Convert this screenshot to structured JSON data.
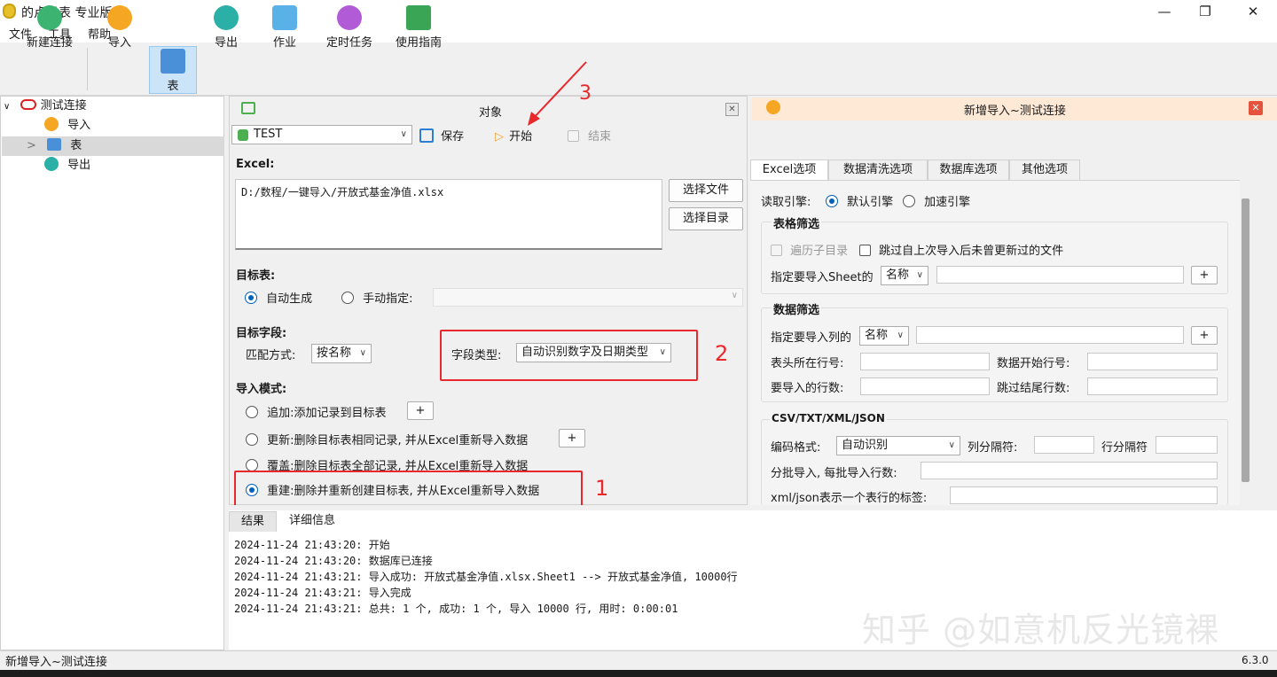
{
  "window": {
    "title": "的卢导表 专业版",
    "minimize": "—",
    "maximize": "❐",
    "close": "✕"
  },
  "menu": [
    "文件",
    "工具",
    "帮助"
  ],
  "toolbar": {
    "new_conn": "新建连接",
    "import": "导入",
    "table": "表",
    "export": "导出",
    "job": "作业",
    "schedule": "定时任务",
    "guide": "使用指南"
  },
  "tree": {
    "root": "测试连接",
    "items": [
      "导入",
      "表",
      "导出"
    ],
    "expander": ">"
  },
  "object_panel": {
    "title": "对象",
    "source_combo": "TEST",
    "save": "保存",
    "start": "开始",
    "stop": "结束",
    "excel_label": "Excel:",
    "excel_path": "D:/数程/一键导入/开放式基金净值.xlsx",
    "choose_file": "选择文件",
    "choose_dir": "选择目录",
    "target_table_label": "目标表:",
    "auto_gen": "自动生成",
    "manual": "手动指定:",
    "target_fields_label": "目标字段:",
    "match_label": "匹配方式:",
    "match_value": "按名称",
    "field_type_label": "字段类型:",
    "field_type_value": "自动识别数字及日期类型",
    "import_mode_label": "导入模式:",
    "modes": [
      "追加:添加记录到目标表",
      "更新:删除目标表相同记录, 并从Excel重新导入数据",
      "覆盖:删除目标表全部记录, 并从Excel重新导入数据",
      "重建:删除并重新创建目标表, 并从Excel重新导入数据"
    ],
    "plus": "+"
  },
  "annotations": [
    "1",
    "2",
    "3"
  ],
  "right_panel": {
    "title": "新增导入~测试连接",
    "tabs": [
      "Excel选项",
      "数据清洗选项",
      "数据库选项",
      "其他选项"
    ],
    "engine_label": "读取引擎:",
    "engine_default": "默认引擎",
    "engine_fast": "加速引擎",
    "sheet_filter": "表格筛选",
    "traverse_sub": "遍历子目录",
    "skip_unchanged": "跳过自上次导入后未曾更新过的文件",
    "specify_sheet": "指定要导入Sheet的",
    "sheet_by": "名称",
    "data_filter": "数据筛选",
    "specify_cols": "指定要导入列的",
    "cols_by": "名称",
    "header_row": "表头所在行号:",
    "data_start_row": "数据开始行号:",
    "rows_to_import": "要导入的行数:",
    "skip_tail_rows": "跳过结尾行数:",
    "csv_group": "CSV/TXT/XML/JSON",
    "encoding_label": "编码格式:",
    "encoding_value": "自动识别",
    "col_sep": "列分隔符:",
    "row_sep": "行分隔符",
    "batch": "分批导入, 每批导入行数:",
    "xml_tag": "xml/json表示一个表行的标签:"
  },
  "results": {
    "tabs": [
      "结果",
      "详细信息"
    ],
    "logs": [
      "2024-11-24 21:43:20: 开始",
      "2024-11-24 21:43:20: 数据库已连接",
      "2024-11-24 21:43:21: 导入成功: 开放式基金净值.xlsx.Sheet1 --> 开放式基金净值, 10000行",
      "2024-11-24 21:43:21: 导入完成",
      "2024-11-24 21:43:21: 总共: 1 个, 成功: 1 个, 导入 10000 行, 用时: 0:00:01"
    ]
  },
  "status": {
    "left": "新增导入~测试连接",
    "version": "6.3.0"
  },
  "watermark": "知乎 @如意机反光镜裸",
  "colors": {
    "accent": "#005fb8",
    "annotation": "#e8282c",
    "selection": "#cce4f7"
  }
}
